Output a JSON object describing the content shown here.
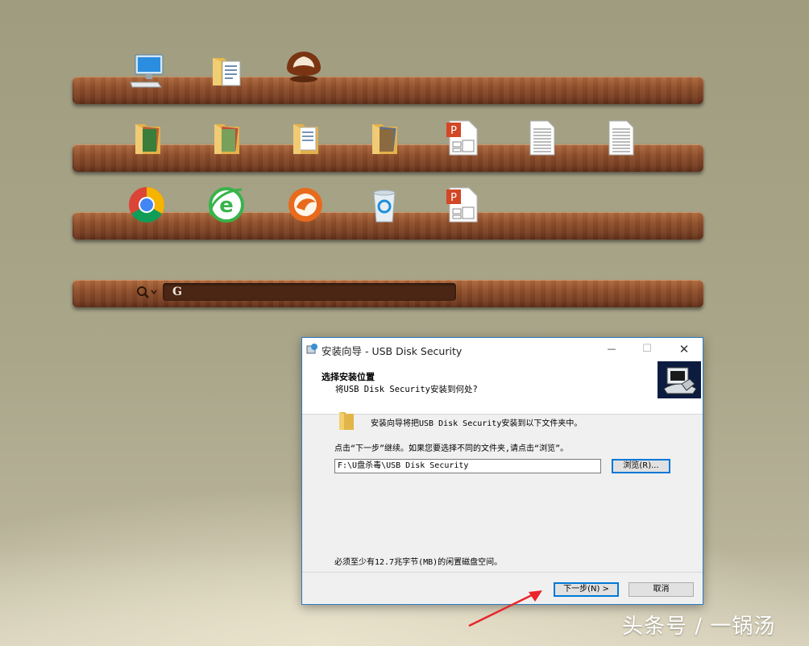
{
  "desktop": {
    "shelf_icons": [
      [
        "computer-icon",
        "document-folder-icon",
        "chestnut-app-icon"
      ],
      [
        "photo-folder-icon",
        "photo-folder-icon",
        "document-folder-icon",
        "photo-folder-icon",
        "ppt-file-icon",
        "text-file-icon",
        "text-file-icon"
      ],
      [
        "chrome-icon",
        "ie-icon",
        "cheetah-browser-icon",
        "recycle-bin-icon",
        "ppt-file-icon"
      ]
    ],
    "search_value": "G"
  },
  "dialog": {
    "title": "安装向导 - USB Disk Security",
    "header_title": "选择安装位置",
    "header_subtitle": "将USB Disk Security安装到何处?",
    "install_message": "安装向导将把USB Disk Security安装到以下文件夹中。",
    "instruction": "点击“下一步”继续。如果您要选择不同的文件夹,请点击“浏览”。",
    "install_path": "F:\\U盘杀毒\\USB Disk Security",
    "browse_label": "浏览(R)...",
    "disk_space": "必须至少有12.7兆字节(MB)的闲置磁盘空间。",
    "next_label": "下一步(N) >",
    "cancel_label": "取消",
    "minimize_glyph": "—",
    "maximize_glyph": "☐",
    "close_glyph": "✕"
  },
  "watermark": "头条号 / 一锅汤",
  "colors": {
    "accent_blue": "#0078d7",
    "shelf_wood": "#8f4f2b",
    "arrow_red": "#e8262b"
  }
}
